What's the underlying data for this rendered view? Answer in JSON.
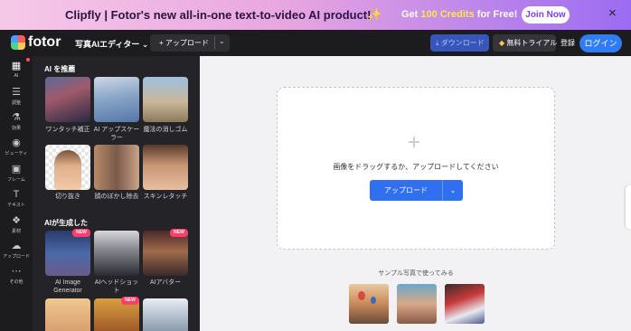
{
  "banner": {
    "text": "Clipfly | Fotor's new all-in-one text-to-video AI product!",
    "spark_icon": "sparkle-icon",
    "credits_prefix": "Get ",
    "credits_highlight": "100 Credits",
    "credits_suffix": " for Free!",
    "join_label": "Join Now",
    "close_icon": "close-icon",
    "colors": {
      "gradient_start": "#f6c9e8",
      "gradient_end": "#9b6cf2"
    }
  },
  "topbar": {
    "brand": "fotor",
    "tool_select": "写真AIエディター",
    "upload_label": "アップロード",
    "download_label": "ダウンロード",
    "trial_label": "無料トライアル",
    "register_label": "登録",
    "login_label": "ログイン",
    "colors": {
      "login": "#2f7cf6",
      "download": "#3d5fd8"
    }
  },
  "rail": {
    "items": [
      {
        "label": "AI",
        "icon": "grid-icon"
      },
      {
        "label": "調整",
        "icon": "sliders-icon"
      },
      {
        "label": "効果",
        "icon": "flask-icon"
      },
      {
        "label": "ビューティ",
        "icon": "eye-icon"
      },
      {
        "label": "フレーム",
        "icon": "frame-icon"
      },
      {
        "label": "テキスト",
        "icon": "text-icon"
      },
      {
        "label": "素材",
        "icon": "elements-icon"
      },
      {
        "label": "アップロード",
        "icon": "cloud-upload-icon"
      },
      {
        "label": "その他",
        "icon": "more-icon"
      }
    ]
  },
  "panel": {
    "recommended_title": "AI を推薦",
    "recommended": [
      {
        "label": "ワンタッチ補正"
      },
      {
        "label": "AI アップスケーラー"
      },
      {
        "label": "魔法の消しゴム"
      },
      {
        "label": "切り抜き"
      },
      {
        "label": "顔のぼかし除去"
      },
      {
        "label": "スキンレタッチ"
      }
    ],
    "generated_title": "AIが生成した",
    "generated": [
      {
        "label": "AI Image Generator",
        "badge": "NEW"
      },
      {
        "label": "AIヘッドショット",
        "badge": ""
      },
      {
        "label": "AIアバター",
        "badge": "NEW"
      },
      {
        "label": "",
        "badge": ""
      },
      {
        "label": "",
        "badge": "NEW"
      },
      {
        "label": "",
        "badge": ""
      }
    ]
  },
  "canvas": {
    "drop_text": "画像をドラッグするか、アップロードしてください",
    "upload_label": "アップロード",
    "sample_title": "サンプル写真で使ってみる"
  }
}
